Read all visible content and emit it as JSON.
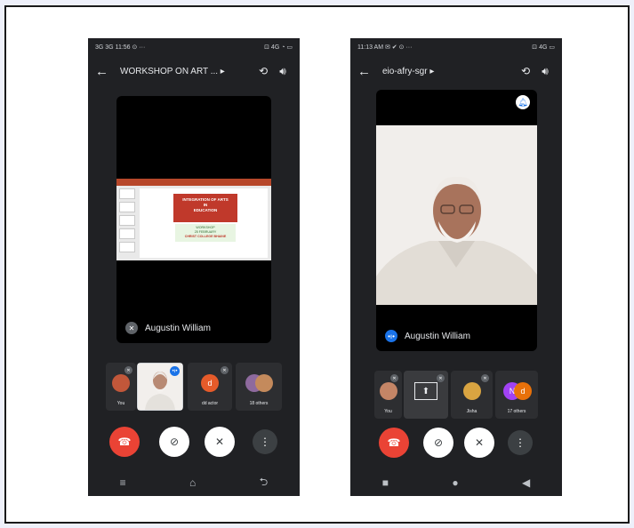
{
  "phone_left": {
    "status_left": "3G 3G 11:56 ⊙ ···",
    "status_right": "⊡ 4G ◔ ▭",
    "back_icon": "arrow-left-icon",
    "title": "WORKSHOP ON ART ... ▸",
    "slide": {
      "title_line1": "INTEGRATION OF ARTS",
      "title_line2": "IN",
      "title_line3": "EDUCATION",
      "sub1": "WORKSHOP",
      "sub2": "25 FEBRUARY",
      "venue": "CHRIST COLLEGE BHAINE"
    },
    "presenter": "Augustin William",
    "tiles": [
      {
        "label": "You",
        "initial": ""
      },
      {
        "label": "",
        "initial": ""
      },
      {
        "label": "dd actor",
        "initial": "d"
      },
      {
        "label": "18 others",
        "initial": ""
      }
    ]
  },
  "phone_right": {
    "status_left": "11:13 AM ✉ ✔ ⊙ ···",
    "status_right": "⊡ 4G ▭",
    "title": "eio-afry-sgr ▸",
    "presenter": "Augustin William",
    "tiles": [
      {
        "label": "You",
        "initial": ""
      },
      {
        "label": "",
        "initial": ""
      },
      {
        "label": "Jisha",
        "initial": ""
      },
      {
        "label": "17 others",
        "initial_a": "N",
        "initial_b": "d"
      }
    ]
  },
  "colors": {
    "phone_bg": "#202124",
    "end_call": "#ea4335",
    "speaking": "#1a73e8",
    "tile_bg": "#2d2e31"
  }
}
